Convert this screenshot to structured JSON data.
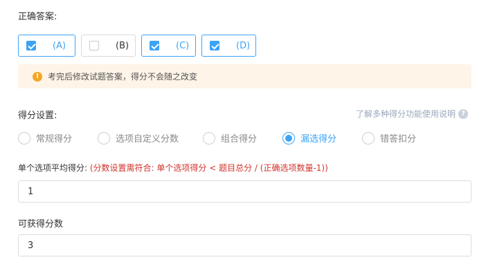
{
  "answer": {
    "label": "正确答案:",
    "options": [
      {
        "label": "(A)",
        "checked": true
      },
      {
        "label": "(B)",
        "checked": false
      },
      {
        "label": "(C)",
        "checked": true
      },
      {
        "label": "(D)",
        "checked": true
      }
    ]
  },
  "warning": {
    "icon": "!",
    "text": "考完后修改试题答案，得分不会随之改变"
  },
  "scoring": {
    "label": "得分设置:",
    "help_link": "了解多种得分功能使用说明",
    "help_icon": "?",
    "options": [
      {
        "label": "常规得分",
        "checked": false
      },
      {
        "label": "选项自定义分数",
        "checked": false
      },
      {
        "label": "组合得分",
        "checked": false
      },
      {
        "label": "漏选得分",
        "checked": true
      },
      {
        "label": "错答扣分",
        "checked": false
      }
    ]
  },
  "avg_score": {
    "label": "单个选项平均得分:",
    "rule": "(分数设置需符合: 单个选项得分 < 题目总分 / (正确选项数量-1))",
    "value": "1"
  },
  "total_score": {
    "label": "可获得分数",
    "value": "3"
  },
  "colors": {
    "accent": "#3da3f5",
    "warning_bg": "#fff4e8",
    "warning_icon": "#f5a623",
    "rule_text": "#d0332b"
  }
}
